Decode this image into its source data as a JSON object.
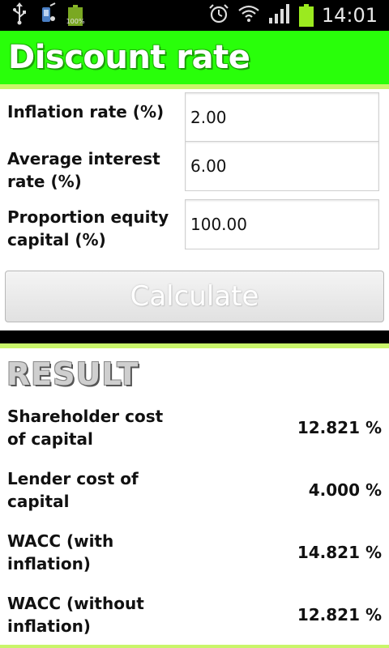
{
  "status_bar": {
    "time": "14:01",
    "battery_small_pct": "100%",
    "icons": [
      "usb-icon",
      "antivirus-icon",
      "battery-full-icon",
      "alarm-icon",
      "wifi-icon",
      "signal-icon",
      "battery-icon"
    ]
  },
  "header": {
    "title": "Discount rate",
    "color": "#29ff0a"
  },
  "form": {
    "rows": [
      {
        "label_line1": "Inflation rate (%)",
        "label_line2": "",
        "value": "2.00"
      },
      {
        "label_line1": "Average interest",
        "label_line2": "rate (%)",
        "value": "6.00"
      },
      {
        "label_line1": "Proportion equity",
        "label_line2": "capital (%)",
        "value": "100.00"
      }
    ],
    "calculate_label": "Calculate"
  },
  "result": {
    "heading": "RESULT",
    "rows": [
      {
        "label_line1": "Shareholder cost",
        "label_line2": "of capital",
        "value": "12.821 %"
      },
      {
        "label_line1": "Lender cost of",
        "label_line2": "capital",
        "value": "4.000 %"
      },
      {
        "label_line1": "WACC (with",
        "label_line2": "inflation)",
        "value": "14.821 %"
      },
      {
        "label_line1": "WACC (without",
        "label_line2": "inflation)",
        "value": "12.821 %"
      }
    ]
  }
}
